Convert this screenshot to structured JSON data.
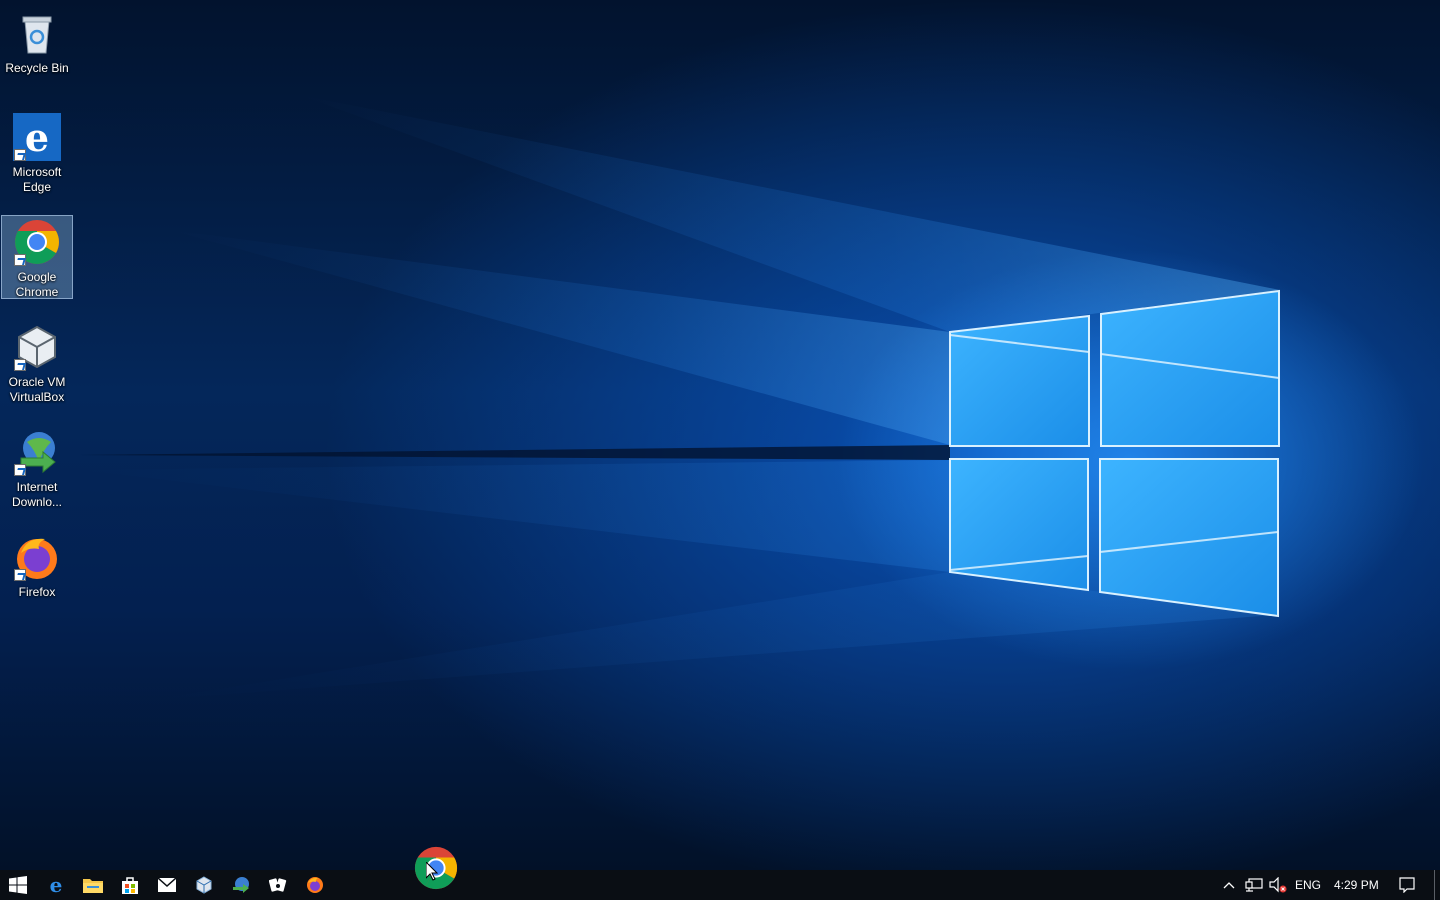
{
  "desktop": {
    "icons": [
      {
        "name": "recycle-bin",
        "label": "Recycle Bin",
        "icon": "recycle-bin-icon",
        "selected": false
      },
      {
        "name": "microsoft-edge",
        "label": "Microsoft\nEdge",
        "icon": "edge-icon",
        "selected": false
      },
      {
        "name": "google-chrome",
        "label": "Google\nChrome",
        "icon": "chrome-icon",
        "selected": true
      },
      {
        "name": "oracle-vm-virtualbox",
        "label": "Oracle VM\nVirtualBox",
        "icon": "virtualbox-icon",
        "selected": false
      },
      {
        "name": "internet-download-manager",
        "label": "Internet\nDownlo...",
        "icon": "idm-icon",
        "selected": false
      },
      {
        "name": "firefox",
        "label": "Firefox",
        "icon": "firefox-icon",
        "selected": false
      }
    ],
    "wallpaper": "windows-10-hero",
    "colors": {
      "accent": "#1a8cff",
      "background_dark": "#021128"
    }
  },
  "taskbar": {
    "pinned": [
      {
        "name": "start",
        "icon": "windows-start-icon"
      },
      {
        "name": "edge",
        "icon": "edge-icon"
      },
      {
        "name": "file-explorer",
        "icon": "folder-icon"
      },
      {
        "name": "store",
        "icon": "store-icon"
      },
      {
        "name": "mail",
        "icon": "mail-icon"
      },
      {
        "name": "virtualbox",
        "icon": "virtualbox-icon"
      },
      {
        "name": "internet-download-manager",
        "icon": "idm-icon"
      },
      {
        "name": "solitaire",
        "icon": "solitaire-icon"
      },
      {
        "name": "firefox",
        "icon": "firefox-icon"
      }
    ],
    "dragging": {
      "icon": "chrome-icon",
      "label": "Google Chrome"
    },
    "tray": {
      "language": "ENG",
      "time": "4:29 PM"
    }
  }
}
